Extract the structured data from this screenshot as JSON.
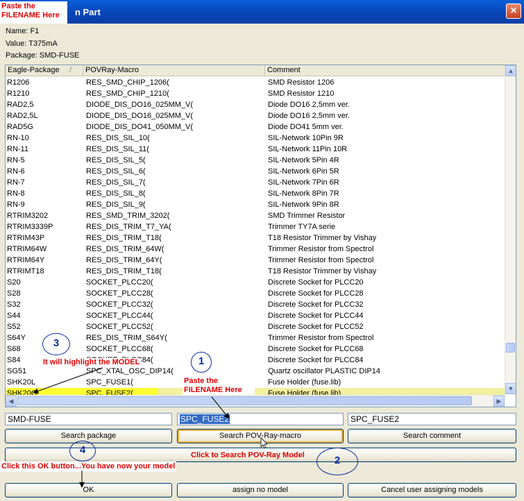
{
  "window": {
    "title_partial": "n Part",
    "close_icon": "×"
  },
  "info": {
    "name": "Name: F1",
    "value": "Value: T375mA",
    "package": "Package: SMD-FUSE"
  },
  "columns": [
    "Eagle-Package",
    "POVRay-Macro",
    "Comment"
  ],
  "sort_indicator": "/",
  "rows": [
    [
      "R1206",
      "RES_SMD_CHIP_1206(",
      "SMD Resistor 1206"
    ],
    [
      "R1210",
      "RES_SMD_CHIP_1210(",
      "SMD Resistor 1210"
    ],
    [
      "RAD2,5",
      "DIODE_DIS_DO16_025MM_V(",
      "Diode DO16 2,5mm ver."
    ],
    [
      "RAD2,5L",
      "DIODE_DIS_DO16_025MM_V(",
      "Diode DO16 2,5mm ver."
    ],
    [
      "RAD5G",
      "DIODE_DIS_DO41_050MM_V(",
      "Diode DO41 5mm ver."
    ],
    [
      "RN-10",
      "RES_DIS_SIL_10(",
      "SIL-Network 10Pin 9R"
    ],
    [
      "RN-11",
      "RES_DIS_SIL_11(",
      "SIL-Network 11Pin 10R"
    ],
    [
      "RN-5",
      "RES_DIS_SIL_5(",
      "SIL-Network 5Pin 4R"
    ],
    [
      "RN-6",
      "RES_DIS_SIL_6(",
      "SIL-Network 6Pin 5R"
    ],
    [
      "RN-7",
      "RES_DIS_SIL_7(",
      "SIL-Network 7Pin 6R"
    ],
    [
      "RN-8",
      "RES_DIS_SIL_8(",
      "SIL-Network 8Pin 7R"
    ],
    [
      "RN-9",
      "RES_DIS_SIL_9(",
      "SIL-Network 9Pin 8R"
    ],
    [
      "RTRIM3202",
      "RES_SMD_TRIM_3202(",
      "SMD Trimmer Resistor"
    ],
    [
      "RTRIM3339P",
      "RES_DIS_TRIM_T7_YA(",
      "Trimmer TY7A serie"
    ],
    [
      "RTRIM43P",
      "RES_DIS_TRIM_T18(",
      "T18 Resistor Trimmer by Vishay"
    ],
    [
      "RTRIM64W",
      "RES_DIS_TRIM_64W(",
      "Trimmer Resistor from Spectrol"
    ],
    [
      "RTRIM64Y",
      "RES_DIS_TRIM_64Y(",
      "Trimmer Resistor from Spectrol"
    ],
    [
      "RTRIMT18",
      "RES_DIS_TRIM_T18(",
      "T18 Resistor Trimmer by Vishay"
    ],
    [
      "S20",
      "SOCKET_PLCC20(",
      "Discrete Socket for  PLCC20"
    ],
    [
      "S28",
      "SOCKET_PLCC28(",
      "Discrete Socket for  PLCC28"
    ],
    [
      "S32",
      "SOCKET_PLCC32(",
      "Discrete Socket for  PLCC32"
    ],
    [
      "S44",
      "SOCKET_PLCC44(",
      "Discrete Socket for  PLCC44"
    ],
    [
      "S52",
      "SOCKET_PLCC52(",
      "Discrete Socket for  PLCC52"
    ],
    [
      "S64Y",
      "RES_DIS_TRIM_S64Y(",
      "Trimmer Resistor from Spectrol"
    ],
    [
      "S68",
      "SOCKET_PLCC68(",
      "Discrete Socket for  PLCC68"
    ],
    [
      "S84",
      "SOCKET_PLCC84(",
      "Discrete Socket for  PLCC84"
    ],
    [
      "SG51",
      "SPC_XTAL_OSC_DIP14(",
      "Quartz oscillator PLASTIC DIP14"
    ],
    [
      "SHK20L",
      "SPC_FUSE1(",
      "Fuse Holder (fuse.lib)"
    ],
    [
      "SHK20Q",
      "SPC_FUSE2(",
      "Fuse Holder (fuse.lib)"
    ]
  ],
  "selected_row": 28,
  "search_fields": {
    "package": "SMD-FUSE",
    "povray": "SPC_FUSE2",
    "comment": "SPC_FUSE2"
  },
  "buttons": {
    "search_package": "Search package",
    "search_povray": "Search POV-Ray-macro",
    "search_comment": "Search comment",
    "ok": "OK",
    "assign_no_model": "assign no model",
    "cancel": "Cancel user assigning models"
  },
  "annotations": {
    "paste_top": "Paste the\nFILENAME Here",
    "paste_mid": "Paste the\nFILENAME Here",
    "highlight": "It will highlight the MODEL",
    "click_search": "Click to Search POV-Ray Model",
    "click_ok": "Click this OK button...You have now your model",
    "n1": "1",
    "n2": "2",
    "n3": "3",
    "n4": "4"
  },
  "scroll_icons": {
    "up": "▲",
    "down": "▼",
    "left": "◀",
    "right": "▶"
  },
  "colors": {
    "titlebar": "#0845b8",
    "annotation": "#e00000",
    "selected_row": "#ffff33",
    "selection": "#316ac5"
  }
}
